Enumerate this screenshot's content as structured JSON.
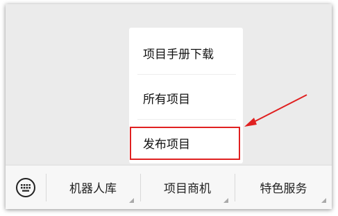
{
  "popup_menu": {
    "items": [
      {
        "label": "项目手册下载"
      },
      {
        "label": "所有项目"
      },
      {
        "label": "发布项目"
      }
    ]
  },
  "bottom_bar": {
    "keyboard_icon": "keyboard-icon",
    "tabs": [
      {
        "label": "机器人库"
      },
      {
        "label": "项目商机"
      },
      {
        "label": "特色服务"
      }
    ]
  },
  "annotation": {
    "color": "#e02020"
  }
}
